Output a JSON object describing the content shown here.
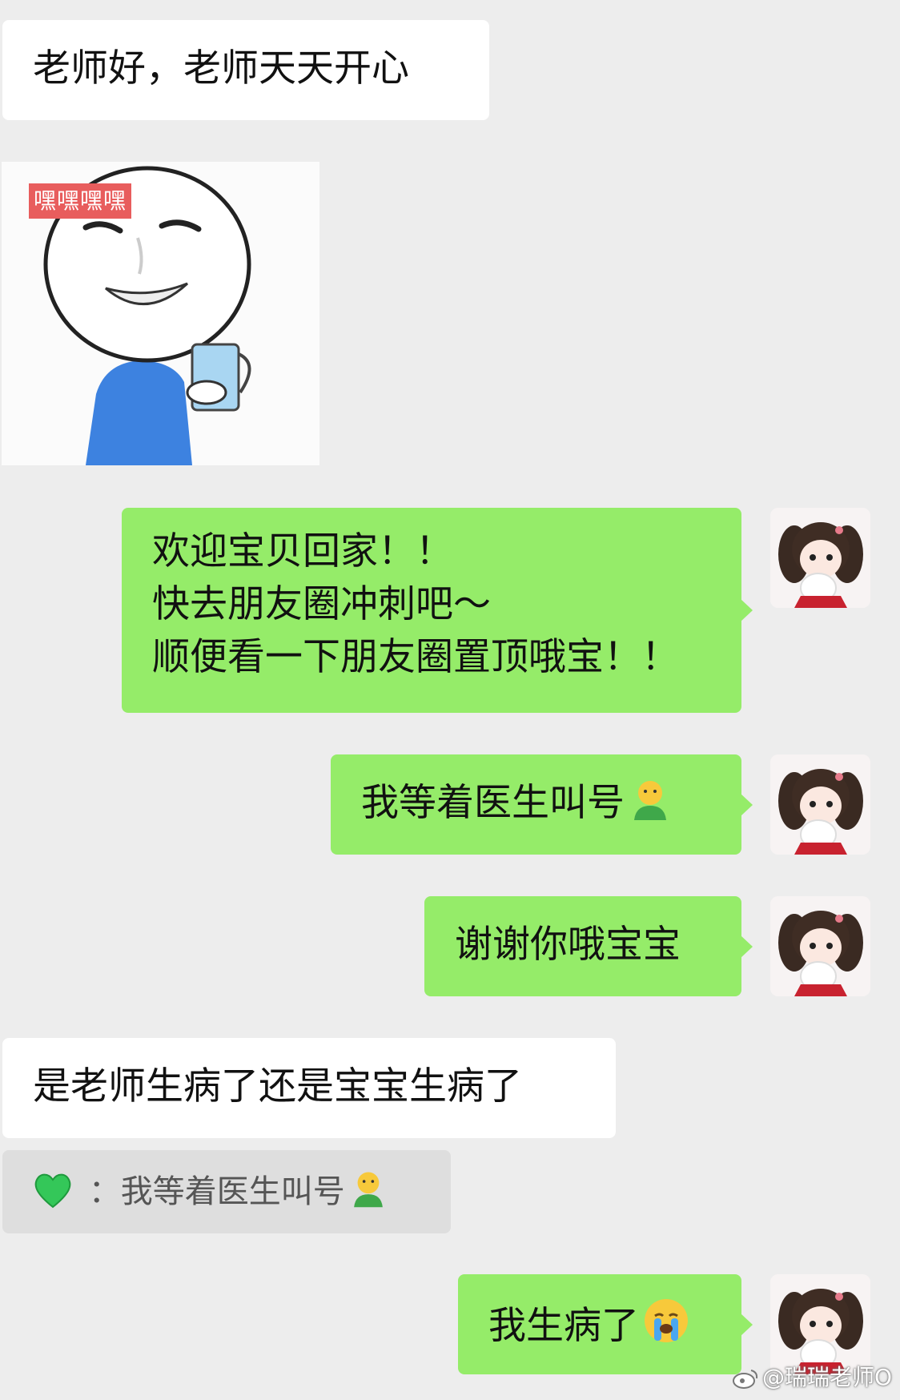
{
  "messages": {
    "m1": "老师好，老师天天开心",
    "sticker_label": "嘿嘿嘿嘿",
    "m3_lines": [
      "欢迎宝贝回家！！",
      "快去朋友圈冲刺吧～",
      "顺便看一下朋友圈置顶哦宝！！"
    ],
    "m4": "我等着医生叫号",
    "m5": "谢谢你哦宝宝",
    "m6": "是老师生病了还是宝宝生病了",
    "quote_sep": "：",
    "quote_text": "我等着医生叫号",
    "m7": "我生病了"
  },
  "icons": {
    "man_emoji": "yellow-green-person-emoji-icon",
    "cry_emoji": "crying-face-emoji-icon",
    "heart": "green-heart-icon",
    "weibo": "weibo-logo-icon"
  },
  "colors": {
    "background": "#ededed",
    "incoming_bubble": "#ffffff",
    "outgoing_bubble": "#95ec69",
    "quote_bg": "#dedede"
  },
  "watermark": "@瑞瑞老师O"
}
